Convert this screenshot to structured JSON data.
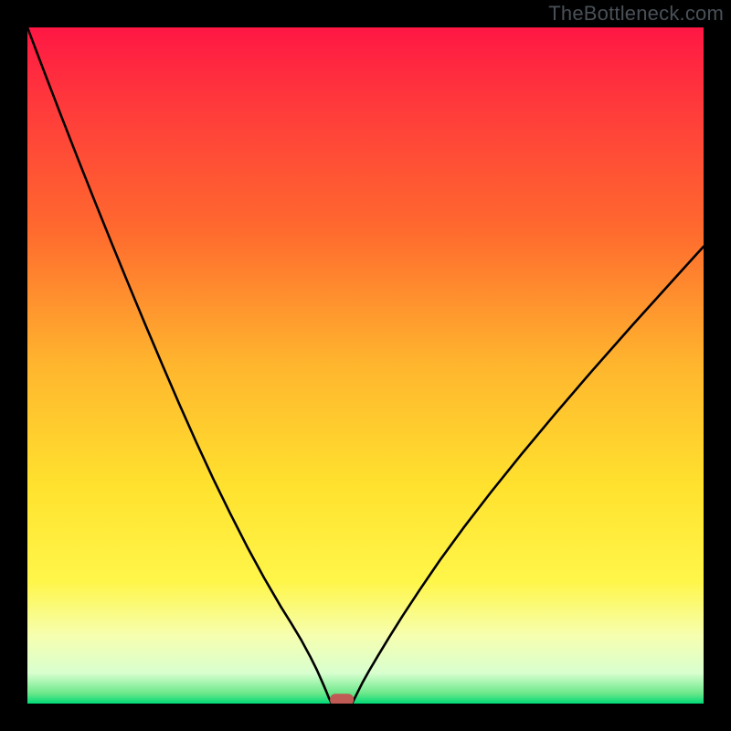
{
  "attribution": "TheBottleneck.com",
  "chart_data": {
    "type": "line",
    "title": "",
    "xlabel": "",
    "ylabel": "",
    "xlim": [
      0,
      100
    ],
    "ylim": [
      0,
      100
    ],
    "gradient_stops": [
      {
        "offset": 0.0,
        "color": "#ff1744"
      },
      {
        "offset": 0.12,
        "color": "#ff3b3b"
      },
      {
        "offset": 0.3,
        "color": "#ff6a2e"
      },
      {
        "offset": 0.5,
        "color": "#ffb62e"
      },
      {
        "offset": 0.68,
        "color": "#ffe22e"
      },
      {
        "offset": 0.82,
        "color": "#fff64a"
      },
      {
        "offset": 0.9,
        "color": "#f6ffb0"
      },
      {
        "offset": 0.955,
        "color": "#d8ffcf"
      },
      {
        "offset": 0.985,
        "color": "#6be88a"
      },
      {
        "offset": 1.0,
        "color": "#00d976"
      }
    ],
    "series": [
      {
        "name": "left-branch",
        "x": [
          0.0,
          2.5,
          5.0,
          7.5,
          10.0,
          12.5,
          15.0,
          17.5,
          20.0,
          22.5,
          25.0,
          27.5,
          30.0,
          32.5,
          35.0,
          37.5,
          39.0,
          40.5,
          41.8,
          42.8,
          43.6,
          44.2,
          44.6,
          44.9,
          45.0
        ],
        "y": [
          100.0,
          93.4,
          86.9,
          80.5,
          74.2,
          68.0,
          61.9,
          55.9,
          50.0,
          44.2,
          38.6,
          33.2,
          28.1,
          23.2,
          18.6,
          14.3,
          11.9,
          9.4,
          7.0,
          5.0,
          3.2,
          1.8,
          0.8,
          0.2,
          0.0
        ]
      },
      {
        "name": "right-branch",
        "x": [
          48.0,
          48.3,
          48.8,
          49.5,
          50.5,
          51.8,
          53.5,
          55.5,
          58.0,
          61.0,
          64.5,
          68.5,
          73.0,
          78.0,
          83.5,
          89.5,
          96.0,
          100.0
        ],
        "y": [
          0.0,
          0.6,
          1.6,
          3.0,
          4.8,
          7.0,
          9.8,
          13.0,
          16.8,
          21.2,
          26.0,
          31.2,
          36.8,
          42.8,
          49.2,
          56.0,
          63.2,
          67.6
        ]
      },
      {
        "name": "flat-segment",
        "x": [
          45.0,
          48.0
        ],
        "y": [
          0.0,
          0.0
        ]
      }
    ],
    "marker": {
      "x": 46.5,
      "y": 0.5,
      "color": "#c05a54"
    }
  }
}
